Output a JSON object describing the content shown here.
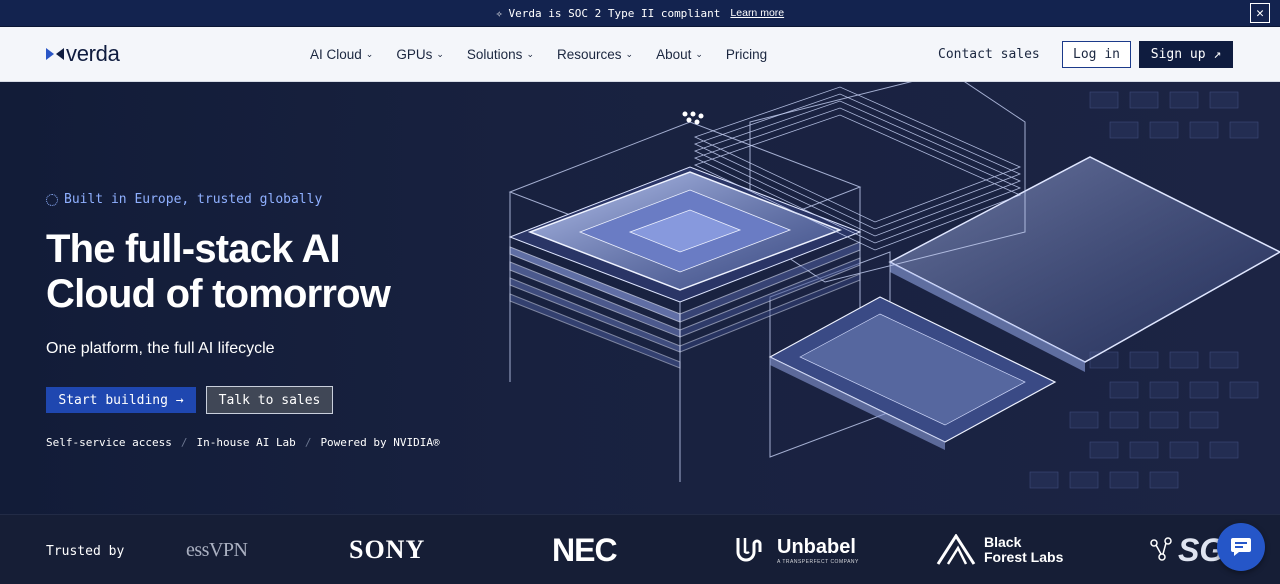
{
  "banner": {
    "text": "Verda is SOC 2 Type II compliant",
    "link": "Learn more",
    "close": "✕"
  },
  "nav": {
    "brand": "verda",
    "items": [
      {
        "label": "AI Cloud",
        "has_dropdown": true
      },
      {
        "label": "GPUs",
        "has_dropdown": true
      },
      {
        "label": "Solutions",
        "has_dropdown": true
      },
      {
        "label": "Resources",
        "has_dropdown": true
      },
      {
        "label": "About",
        "has_dropdown": true
      },
      {
        "label": "Pricing",
        "has_dropdown": false
      }
    ],
    "contact": "Contact sales",
    "login": "Log in",
    "signup": "Sign up ↗"
  },
  "hero": {
    "tagline": "Built in Europe, trusted globally",
    "headline_line1": "The full-stack AI",
    "headline_line2": "Cloud of tomorrow",
    "subline": "One platform, the full AI lifecycle",
    "primary_cta": "Start building →",
    "secondary_cta": "Talk to sales",
    "features": [
      "Self-service access",
      "In-house AI Lab",
      "Powered by NVIDIA®"
    ],
    "separator": "/"
  },
  "trusted": {
    "label": "Trusted by",
    "logos": [
      "essVPN",
      "SONY",
      "NEC",
      "Unbabel",
      "Black",
      "Forest Labs",
      "SG"
    ],
    "unbabel_tagline": "A TRANSPERFECT COMPANY"
  },
  "colors": {
    "banner_bg": "#13234f",
    "nav_bg": "#f4f6fa",
    "brand_navy": "#0f1c3f",
    "accent_blue": "#1f47b0",
    "tagline_blue": "#8fb0ff",
    "hero_bg": "#18213f",
    "chat_blue": "#2556c8"
  }
}
